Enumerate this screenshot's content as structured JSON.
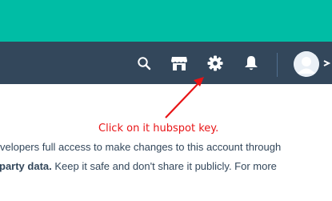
{
  "colors": {
    "header_teal": "#00bda5",
    "nav_dark": "#33475b",
    "annotation_red": "#e81416",
    "body_text": "#33475b"
  },
  "nav": {
    "icons": [
      "search-icon",
      "marketplace-icon",
      "settings-icon",
      "notifications-icon"
    ],
    "avatar": "user-avatar-icon"
  },
  "annotation": {
    "text": "Click on it hubspot key."
  },
  "content": {
    "line1": "velopers full access to make changes to this account through",
    "line2_bold": "party data.",
    "line2_rest": " Keep it safe and don't share it publicly. For more"
  }
}
